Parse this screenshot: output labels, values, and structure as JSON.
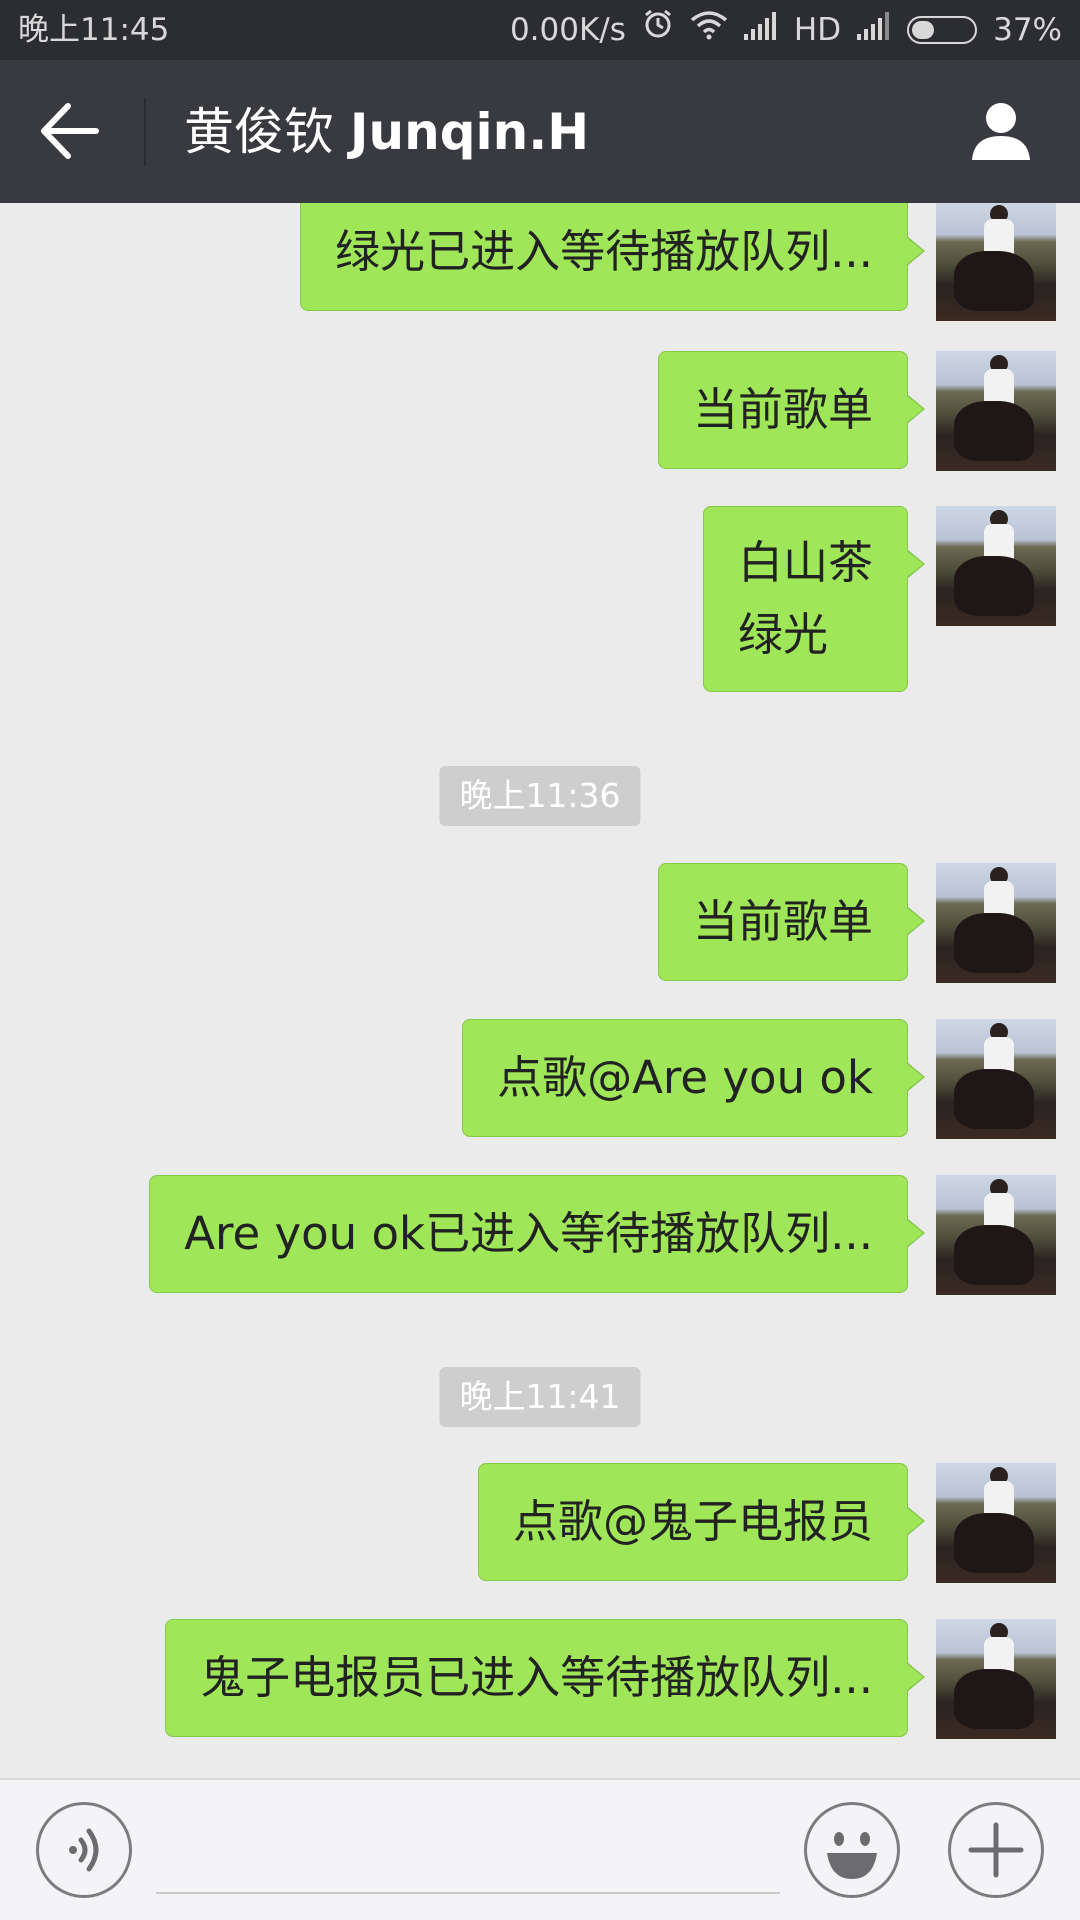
{
  "status_bar": {
    "time": "晚上11:45",
    "network_speed": "0.00K/s",
    "hd_label": "HD",
    "battery": "37%",
    "battery_level": 0.37,
    "icons": [
      "alarm-icon",
      "wifi-icon",
      "signal-icon",
      "signal-icon-2",
      "battery-icon"
    ]
  },
  "header": {
    "title_cn": "黄俊钦",
    "title_latin": "Junqin.H",
    "back_icon": "back-arrow-icon",
    "profile_icon": "person-icon"
  },
  "messages": [
    {
      "type": "sent",
      "text": "绿光已进入等待播放队列..."
    },
    {
      "type": "sent",
      "text": "当前歌单"
    },
    {
      "type": "sent",
      "lines": [
        "白山茶",
        "绿光"
      ]
    },
    {
      "type": "time",
      "text": "晚上11:36"
    },
    {
      "type": "sent",
      "text": "当前歌单"
    },
    {
      "type": "sent",
      "text": "点歌@Are you ok"
    },
    {
      "type": "sent",
      "text": "Are you ok已进入等待播放队列..."
    },
    {
      "type": "time",
      "text": "晚上11:41"
    },
    {
      "type": "sent",
      "text": "点歌@鬼子电报员"
    },
    {
      "type": "sent",
      "text": "鬼子电报员已进入等待播放队列..."
    }
  ],
  "input_bar": {
    "voice_icon": "voice-icon",
    "emoji_icon": "emoji-icon",
    "plus_icon": "plus-icon",
    "placeholder": ""
  },
  "colors": {
    "status_bar_bg": "#2c2d31",
    "title_bar_bg": "#393a3f",
    "chat_bg": "#ebebeb",
    "bubble_green": "#9fe658",
    "timestamp_bg": "#cecece"
  }
}
